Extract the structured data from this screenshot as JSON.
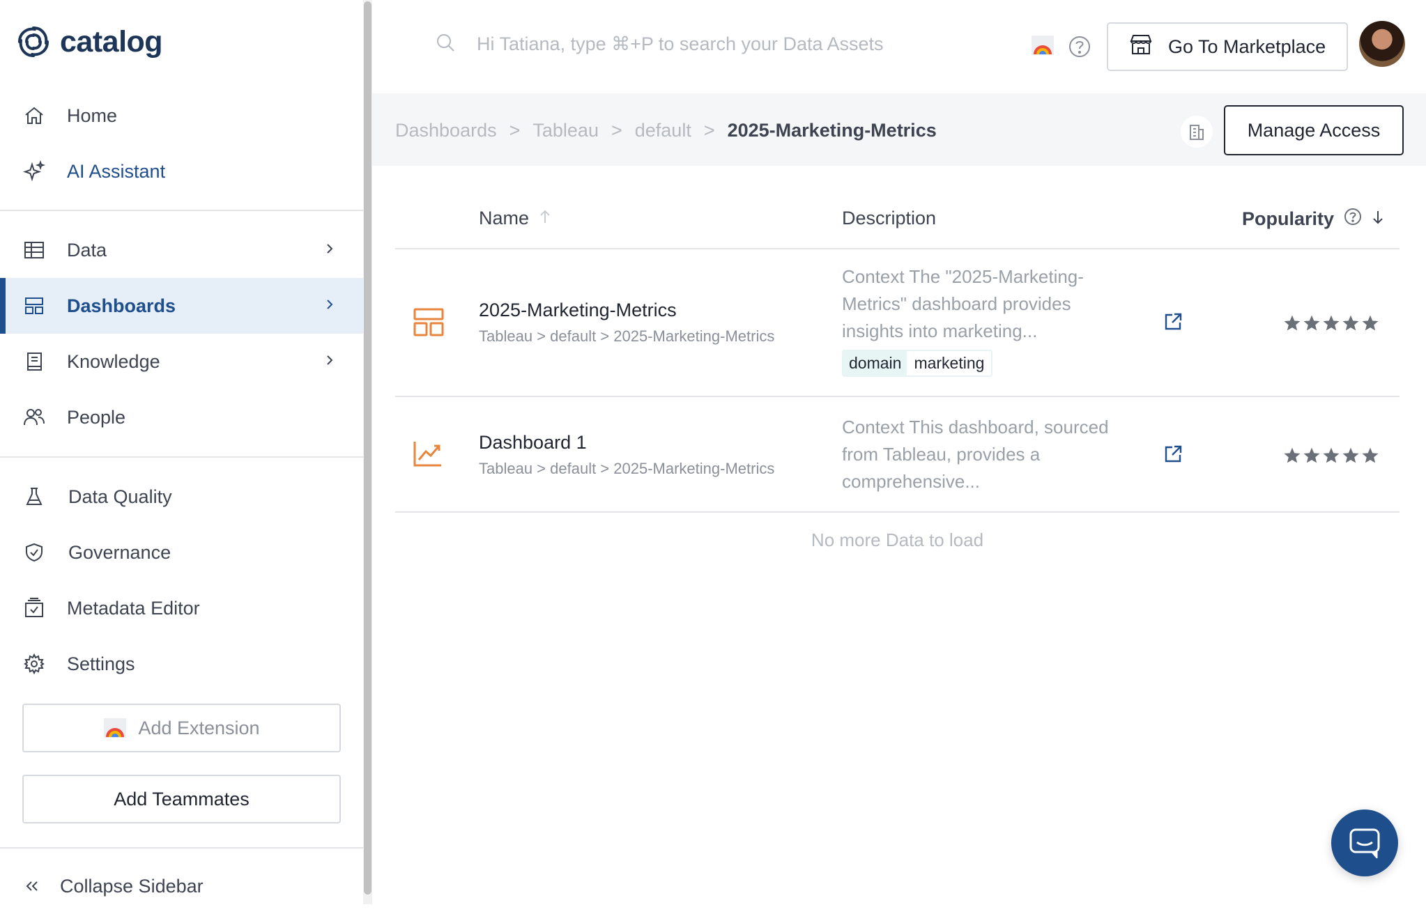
{
  "app": {
    "logo_text": "catalog"
  },
  "sidebar": {
    "primary": [
      {
        "label": "Home",
        "icon": "home-icon"
      },
      {
        "label": "AI Assistant",
        "icon": "sparkle-icon"
      }
    ],
    "sections": [
      {
        "label": "Data",
        "icon": "table-icon",
        "expandable": true
      },
      {
        "label": "Dashboards",
        "icon": "dashboard-icon",
        "expandable": true,
        "active": true
      },
      {
        "label": "Knowledge",
        "icon": "book-icon",
        "expandable": true
      },
      {
        "label": "People",
        "icon": "people-icon"
      }
    ],
    "tools": [
      {
        "label": "Data Quality",
        "icon": "flask-icon"
      },
      {
        "label": "Governance",
        "icon": "shield-check-icon"
      },
      {
        "label": "Metadata Editor",
        "icon": "calendar-check-icon"
      },
      {
        "label": "Settings",
        "icon": "gear-icon"
      }
    ],
    "add_extension": "Add Extension",
    "add_teammates": "Add Teammates",
    "collapse": "Collapse Sidebar"
  },
  "topbar": {
    "search_placeholder": "Hi Tatiana, type ⌘+P to search your Data Assets",
    "marketplace_label": "Go To Marketplace"
  },
  "breadcrumb": {
    "items": [
      "Dashboards",
      "Tableau",
      "default"
    ],
    "current": "2025-Marketing-Metrics",
    "separator": ">",
    "manage_access": "Manage Access"
  },
  "table": {
    "columns": {
      "name": "Name",
      "description": "Description",
      "popularity": "Popularity"
    },
    "rows": [
      {
        "name": "2025-Marketing-Metrics",
        "path": "Tableau > default > 2025-Marketing-Metrics",
        "description": "Context The \"2025-Marketing-Metrics\" dashboard provides insights into marketing...",
        "tag_key": "domain",
        "tag_value": "marketing",
        "icon": "dashboard-layout-icon",
        "popularity": 5
      },
      {
        "name": "Dashboard 1",
        "path": "Tableau > default > 2025-Marketing-Metrics",
        "description": "Context This dashboard, sourced from Tableau, provides a comprehensive...",
        "icon": "line-chart-icon",
        "popularity": 5
      }
    ],
    "footer": "No more Data to load"
  },
  "colors": {
    "accent": "#1e4e8c",
    "asset_icon": "#e8853d",
    "active_bg": "#e6eef8",
    "star": "#6b7078"
  }
}
